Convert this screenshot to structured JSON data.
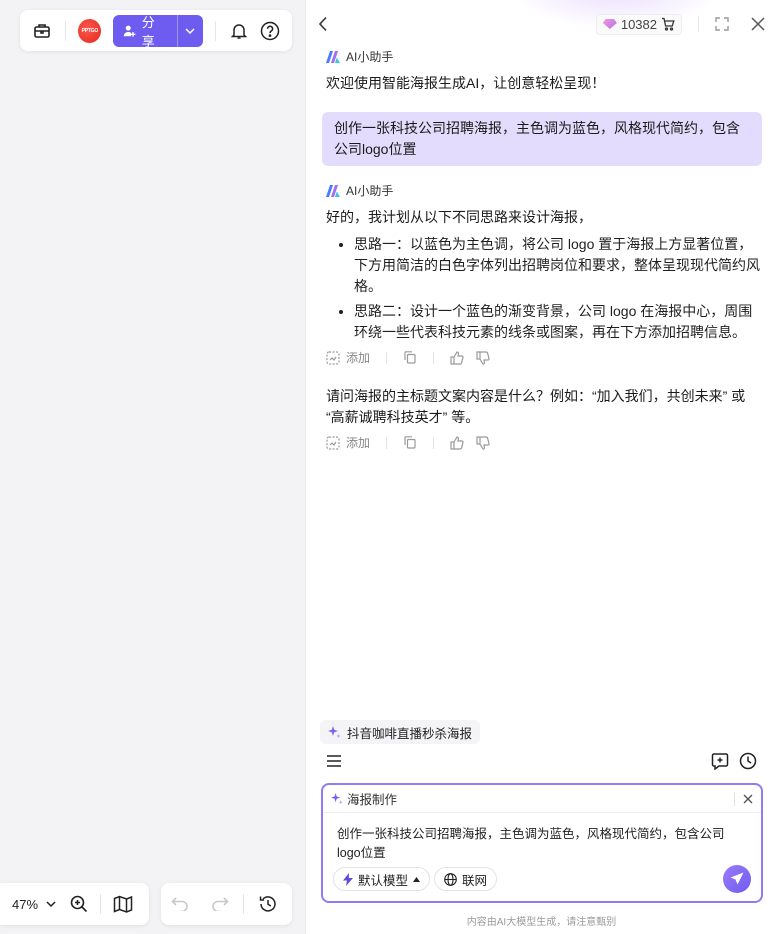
{
  "toolbar": {
    "logo_text": "PPTGO",
    "share_label": "分享"
  },
  "zoom": {
    "value": "47%"
  },
  "panel": {
    "credits": "10382",
    "colors": {
      "accent": "#6e5cf0",
      "user_bubble": "#e4dcfd"
    }
  },
  "chat": {
    "assistant_name": "AI小助手",
    "welcome": "欢迎使用智能海报生成AI，让创意轻松呈现！",
    "user_message": "创作一张科技公司招聘海报，主色调为蓝色，风格现代简约，包含公司logo位置",
    "reply_intro": "好的，我计划从以下不同思路来设计海报，",
    "reply_ideas": [
      "思路一：以蓝色为主色调，将公司 logo 置于海报上方显著位置，下方用简洁的白色字体列出招聘岗位和要求，整体呈现现代简约风格。",
      "思路二：设计一个蓝色的渐变背景，公司 logo 在海报中心，周围环绕一些代表科技元素的线条或图案，再在下方添加招聘信息。"
    ],
    "add_label": "添加",
    "followup": "请问海报的主标题文案内容是什么？例如：“加入我们，共创未来” 或 “高薪诚聘科技英才” 等。"
  },
  "suggestion": {
    "label": "抖音咖啡直播秒杀海报"
  },
  "composer": {
    "mode_label": "海报制作",
    "text": "创作一张科技公司招聘海报，主色调为蓝色，风格现代简约，包含公司logo位置",
    "model_label": "默认模型",
    "web_label": "联网"
  },
  "disclaimer": "内容由AI大模型生成，请注意甄别"
}
